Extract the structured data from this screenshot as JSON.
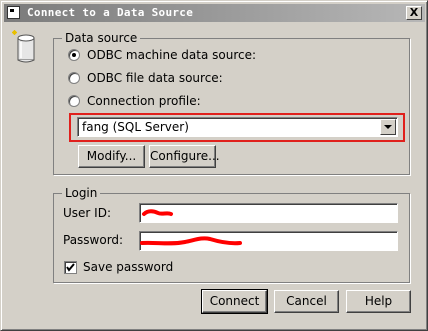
{
  "window": {
    "title": "Connect to a Data Source",
    "close_label": "X"
  },
  "data_source": {
    "legend": "Data source",
    "options": [
      {
        "label": "ODBC machine data source:",
        "checked": true
      },
      {
        "label": "ODBC file data source:",
        "checked": false
      },
      {
        "label": "Connection profile:",
        "checked": false
      }
    ],
    "selected_source": "fang (SQL Server)",
    "modify_label": "Modify...",
    "configure_label": "Configure..."
  },
  "login": {
    "legend": "Login",
    "user_id_label": "User ID:",
    "password_label": "Password:",
    "save_password_label": "Save password",
    "save_password_checked": true
  },
  "buttons": {
    "connect": "Connect",
    "cancel": "Cancel",
    "help": "Help"
  },
  "colors": {
    "highlight": "#e0201c",
    "redaction": "#ff0000"
  }
}
